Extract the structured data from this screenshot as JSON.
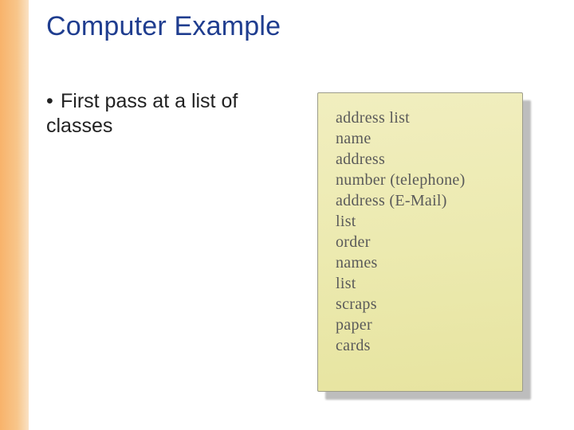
{
  "title": "Computer Example",
  "bullet": {
    "text": "First pass at a list of classes"
  },
  "note": {
    "lines": [
      "address list",
      "name",
      "address",
      "number (telephone)",
      "address (E-Mail)",
      "list",
      "order",
      "names",
      "list",
      "scraps",
      "paper",
      "cards"
    ]
  }
}
